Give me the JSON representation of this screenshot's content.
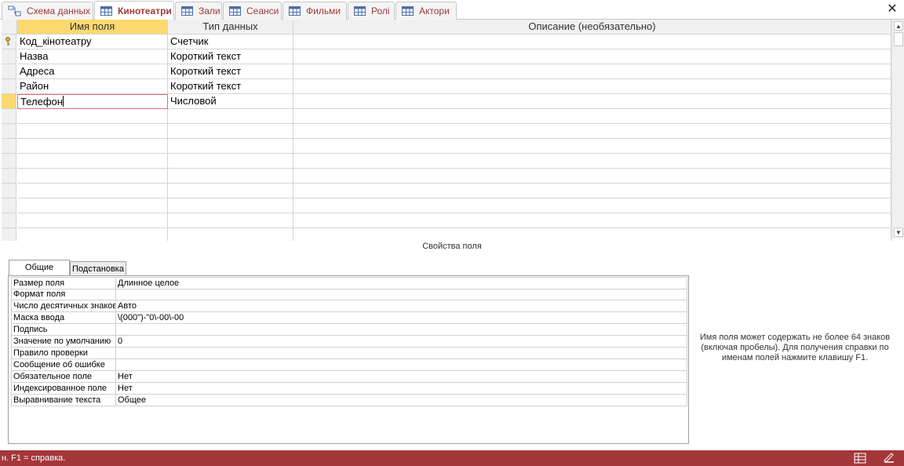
{
  "tabs": [
    {
      "label": "Схема данных",
      "icon": "relationships-icon",
      "active": false
    },
    {
      "label": "Кинотеатри",
      "icon": "table-icon",
      "active": true
    },
    {
      "label": "Зали",
      "icon": "table-icon",
      "active": false
    },
    {
      "label": "Сеанси",
      "icon": "table-icon",
      "active": false
    },
    {
      "label": "Фильми",
      "icon": "table-icon",
      "active": false
    },
    {
      "label": "Ролі",
      "icon": "table-icon",
      "active": false
    },
    {
      "label": "Актори",
      "icon": "table-icon",
      "active": false
    }
  ],
  "close_label": "✕",
  "design_grid": {
    "headers": {
      "field_name": "Имя поля",
      "data_type": "Тип данных",
      "description": "Описание (необязательно)"
    },
    "rows": [
      {
        "name": "Код_кінотеатру",
        "type": "Счетчик",
        "description": "",
        "primary_key": true
      },
      {
        "name": "Назва",
        "type": "Короткий текст",
        "description": ""
      },
      {
        "name": "Адреса",
        "type": "Короткий текст",
        "description": ""
      },
      {
        "name": "Район",
        "type": "Короткий текст",
        "description": ""
      },
      {
        "name": "Телефон",
        "type": "Числовой",
        "description": "",
        "current": true
      }
    ],
    "empty_rows": 9
  },
  "properties": {
    "title": "Свойства поля",
    "tabs": {
      "general": "Общие",
      "lookup": "Подстановка"
    },
    "rows": [
      {
        "label": "Размер поля",
        "value": "Длинное целое"
      },
      {
        "label": "Формат поля",
        "value": ""
      },
      {
        "label": "Число десятичных знаков",
        "value": "Авто"
      },
      {
        "label": "Маска ввода",
        "value": "\\(000\")-\"0\\-00\\-00"
      },
      {
        "label": "Подпись",
        "value": ""
      },
      {
        "label": "Значение по умолчанию",
        "value": "0"
      },
      {
        "label": "Правило проверки",
        "value": ""
      },
      {
        "label": "Сообщение об ошибке",
        "value": ""
      },
      {
        "label": "Обязательное поле",
        "value": "Нет"
      },
      {
        "label": "Индексированное поле",
        "value": "Нет"
      },
      {
        "label": "Выравнивание текста",
        "value": "Общее"
      }
    ],
    "help": "Имя поля может содержать не более 64 знаков (включая пробелы). Для получения справки по именам полей нажмите клавишу F1."
  },
  "status_bar": {
    "text": "н.  F1 = справка.",
    "color": "#a4373a"
  },
  "colors": {
    "accent": "#a4373a",
    "selected_header": "#fbd96e"
  }
}
